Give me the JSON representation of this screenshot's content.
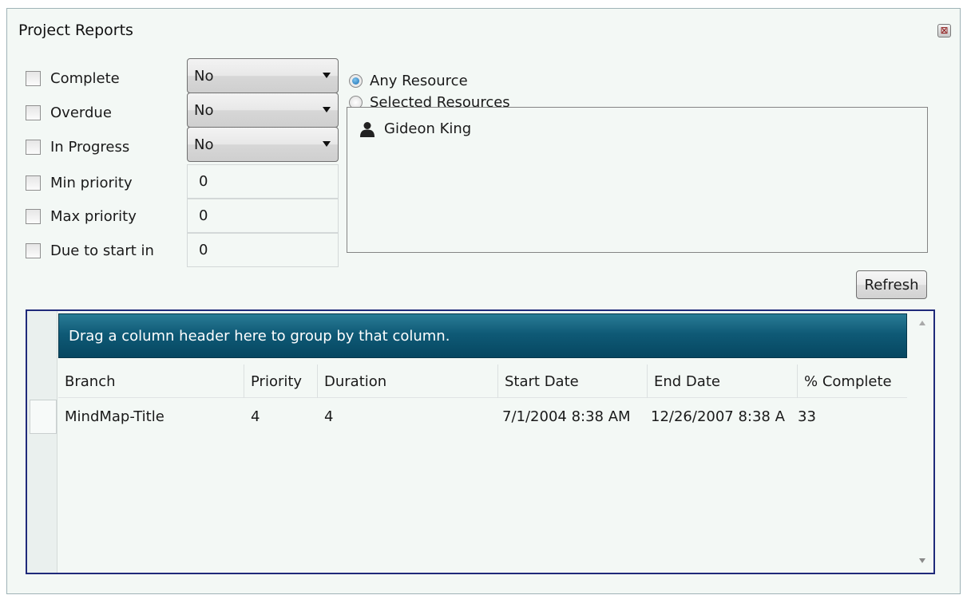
{
  "window": {
    "title": "Project Reports",
    "close_glyph": "⊠"
  },
  "filters": [
    {
      "label": "Complete",
      "control": "dropdown",
      "value": "No"
    },
    {
      "label": "Overdue",
      "control": "dropdown",
      "value": "No"
    },
    {
      "label": "In Progress",
      "control": "dropdown",
      "value": "No"
    },
    {
      "label": "Min priority",
      "control": "textbox",
      "value": "0"
    },
    {
      "label": "Max priority",
      "control": "textbox",
      "value": "0"
    },
    {
      "label": "Due to start in",
      "control": "textbox",
      "value": "0"
    }
  ],
  "resources": {
    "any_label": "Any Resource",
    "selected_label": "Selected Resources",
    "selected_option": "any",
    "items": [
      {
        "name": "Gideon King",
        "icon": "person-icon"
      }
    ]
  },
  "refresh_label": "Refresh",
  "grid": {
    "group_panel_text": "Drag a column header here to group by that column.",
    "columns": [
      "Branch",
      "Priority",
      "Duration",
      "Start Date",
      "End Date",
      "% Complete"
    ],
    "rows": [
      [
        "MindMap-Title",
        "4",
        "4",
        "7/1/2004 8:38 AM",
        "12/26/2007 8:38 A",
        "33"
      ]
    ]
  },
  "colors": {
    "group_panel": "#0f5a76",
    "grid_border": "#1f2a7a",
    "window_bg": "#f3f8f5"
  }
}
